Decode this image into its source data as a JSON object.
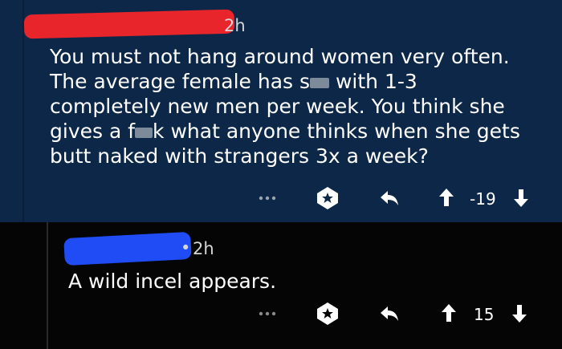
{
  "comments": [
    {
      "time": "2h",
      "lines": [
        [
          "You must not hang around women very often.",
          "",
          ""
        ],
        [
          "The average female has s",
          "",
          " with 1-3"
        ],
        [
          "completely new men per week. You think she",
          "",
          ""
        ],
        [
          "gives a f",
          "",
          "k what anyone thinks when she gets"
        ],
        [
          "butt naked with strangers 3x a week?",
          "",
          ""
        ]
      ],
      "score": "-19",
      "colors": {
        "background": "#0c2747",
        "redaction": "#e8252b"
      },
      "icons": [
        "more-icon",
        "award-icon",
        "reply-icon",
        "upvote-icon",
        "downvote-icon"
      ]
    },
    {
      "time": "2h",
      "text": "A wild incel appears.",
      "score": "15",
      "colors": {
        "background": "#050505",
        "redaction": "#1f4cf5"
      },
      "icons": [
        "more-icon",
        "award-icon",
        "reply-icon",
        "upvote-icon",
        "downvote-icon"
      ]
    }
  ]
}
